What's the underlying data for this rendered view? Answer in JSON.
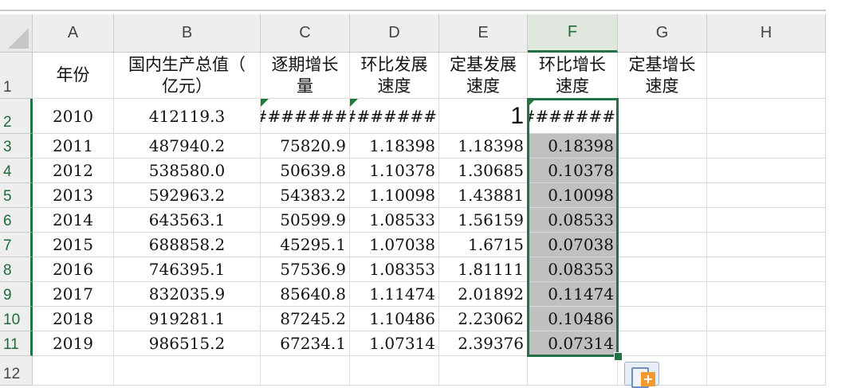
{
  "columns": [
    "A",
    "B",
    "C",
    "D",
    "E",
    "F",
    "G",
    "H"
  ],
  "row_numbers": [
    "1",
    "2",
    "3",
    "4",
    "5",
    "6",
    "7",
    "8",
    "9",
    "10",
    "11",
    "12"
  ],
  "selected_column": "F",
  "header_row": {
    "A": [
      "年份"
    ],
    "B": [
      "国内生产总值（",
      "亿元）"
    ],
    "C": [
      "逐期增长",
      "量"
    ],
    "D": [
      "环比发展",
      "速度"
    ],
    "E": [
      "定基发展",
      "速度"
    ],
    "F": [
      "环比增长",
      "速度"
    ],
    "G": [
      "定基增长",
      "速度"
    ]
  },
  "rows": [
    {
      "A": "2010",
      "B": "412119.3",
      "C": "#######",
      "D": "#######",
      "E": "1",
      "F": "#######"
    },
    {
      "A": "2011",
      "B": "487940.2",
      "C": "75820.9",
      "D": "1.18398",
      "E": "1.18398",
      "F": "0.18398"
    },
    {
      "A": "2012",
      "B": "538580.0",
      "C": "50639.8",
      "D": "1.10378",
      "E": "1.30685",
      "F": "0.10378"
    },
    {
      "A": "2013",
      "B": "592963.2",
      "C": "54383.2",
      "D": "1.10098",
      "E": "1.43881",
      "F": "0.10098"
    },
    {
      "A": "2014",
      "B": "643563.1",
      "C": "50599.9",
      "D": "1.08533",
      "E": "1.56159",
      "F": "0.08533"
    },
    {
      "A": "2015",
      "B": "688858.2",
      "C": "45295.1",
      "D": "1.07038",
      "E": "1.6715",
      "F": "0.07038"
    },
    {
      "A": "2016",
      "B": "746395.1",
      "C": "57536.9",
      "D": "1.08353",
      "E": "1.81111",
      "F": "0.08353"
    },
    {
      "A": "2017",
      "B": "832035.9",
      "C": "85640.8",
      "D": "1.11474",
      "E": "2.01892",
      "F": "0.11474"
    },
    {
      "A": "2018",
      "B": "919281.1",
      "C": "87245.2",
      "D": "1.10486",
      "E": "2.23062",
      "F": "0.10486"
    },
    {
      "A": "2019",
      "B": "986515.2",
      "C": "67234.1",
      "D": "1.07314",
      "E": "2.39376",
      "F": "0.07314"
    }
  ],
  "colors": {
    "selection": "#217346",
    "shade": "#c0c0c0"
  }
}
